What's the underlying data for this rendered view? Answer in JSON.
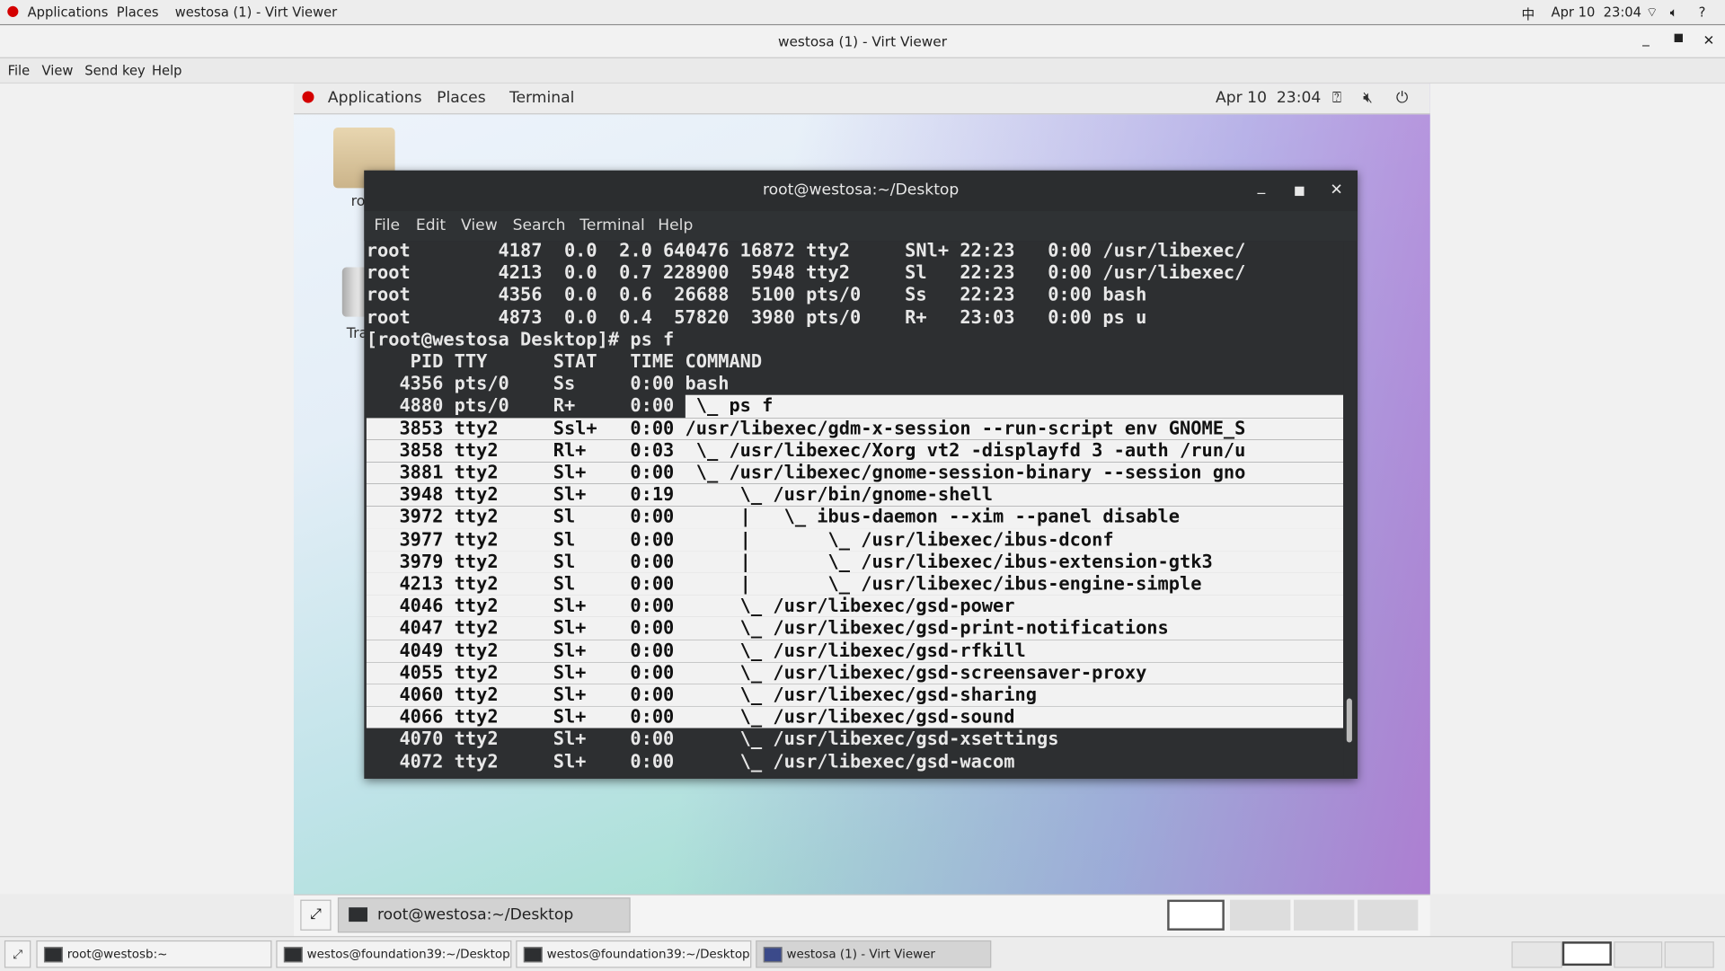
{
  "host_topbar": {
    "applications": "Applications",
    "places": "Places",
    "window": "westosa (1) - Virt Viewer",
    "input_method": "中",
    "clock": "Apr 10  23:04"
  },
  "viewer": {
    "title": "westosa (1) - Virt Viewer",
    "menu": [
      "File",
      "View",
      "Send key",
      "Help"
    ]
  },
  "guest_panel": {
    "applications": "Applications",
    "places": "Places",
    "terminal": "Terminal",
    "clock": "Apr 10  23:04"
  },
  "desktop_icons": [
    {
      "label": "root"
    },
    {
      "label": "Trash"
    }
  ],
  "terminal": {
    "title": "root@westosa:~/Desktop",
    "menu": [
      "File",
      "Edit",
      "View",
      "Search",
      "Terminal",
      "Help"
    ],
    "lines": [
      {
        "text": "root        4187  0.0  2.0 640476 16872 tty2     SNl+ 22:23   0:00 /usr/libexec/",
        "sel": ""
      },
      {
        "text": "root        4213  0.0  0.7 228900  5948 tty2     Sl   22:23   0:00 /usr/libexec/",
        "sel": ""
      },
      {
        "text": "root        4356  0.0  0.6  26688  5100 pts/0    Ss   22:23   0:00 bash",
        "sel": ""
      },
      {
        "text": "root        4873  0.0  0.4  57820  3980 pts/0    R+   23:03   0:00 ps u",
        "sel": ""
      },
      {
        "text": "[root@westosa Desktop]# ps f",
        "sel": ""
      },
      {
        "text": "    PID TTY      STAT   TIME COMMAND",
        "sel": ""
      },
      {
        "text": "   4356 pts/0    Ss     0:00 bash",
        "sel": ""
      },
      {
        "text": "   4880 pts/0    R+     0:00 ",
        "sel": " \\_ ps f"
      },
      {
        "text": "",
        "sel": "   3853 tty2     Ssl+   0:00 /usr/libexec/gdm-x-session --run-script env GNOME_S"
      },
      {
        "text": "",
        "sel": "   3858 tty2     Rl+    0:03  \\_ /usr/libexec/Xorg vt2 -displayfd 3 -auth /run/u"
      },
      {
        "text": "",
        "sel": "   3881 tty2     Sl+    0:00  \\_ /usr/libexec/gnome-session-binary --session gno"
      },
      {
        "text": "",
        "sel": "   3948 tty2     Sl+    0:19      \\_ /usr/bin/gnome-shell"
      },
      {
        "text": "",
        "sel": "   3972 tty2     Sl     0:00      |   \\_ ibus-daemon --xim --panel disable"
      },
      {
        "text": "",
        "sel": "   3977 tty2     Sl     0:00      |       \\_ /usr/libexec/ibus-dconf"
      },
      {
        "text": "",
        "sel": "   3979 tty2     Sl     0:00      |       \\_ /usr/libexec/ibus-extension-gtk3"
      },
      {
        "text": "",
        "sel": "   4213 tty2     Sl     0:00      |       \\_ /usr/libexec/ibus-engine-simple"
      },
      {
        "text": "",
        "sel": "   4046 tty2     Sl+    0:00      \\_ /usr/libexec/gsd-power"
      },
      {
        "text": "",
        "sel": "   4047 tty2     Sl+    0:00      \\_ /usr/libexec/gsd-print-notifications"
      },
      {
        "text": "",
        "sel": "   4049 tty2     Sl+    0:00      \\_ /usr/libexec/gsd-rfkill"
      },
      {
        "text": "",
        "sel": "   4055 tty2     Sl+    0:00      \\_ /usr/libexec/gsd-screensaver-proxy"
      },
      {
        "text": "",
        "sel": "   4060 tty2     Sl+    0:00      \\_ /usr/libexec/gsd-sharing"
      },
      {
        "text": "",
        "sel": "   4066 tty2     Sl+    0:00      \\_ /usr/libexec/gsd-sound"
      },
      {
        "text": "   4070 tty2     Sl+    0:00      \\_ /usr/libexec/gsd-xsettings",
        "sel": ""
      },
      {
        "text": "   4072 tty2     Sl+    0:00      \\_ /usr/libexec/gsd-wacom",
        "sel": ""
      }
    ]
  },
  "guest_taskbar": {
    "window": "root@westosa:~/Desktop"
  },
  "host_taskbar": {
    "windows": [
      "root@westosb:~",
      "westos@foundation39:~/Desktop",
      "westos@foundation39:~/Desktop",
      "westosa (1) - Virt Viewer"
    ]
  },
  "colors": {
    "terminal_bg": "#2d2f31",
    "selection_bg": "#f2f2f2",
    "redhat_red": "#d40000"
  }
}
